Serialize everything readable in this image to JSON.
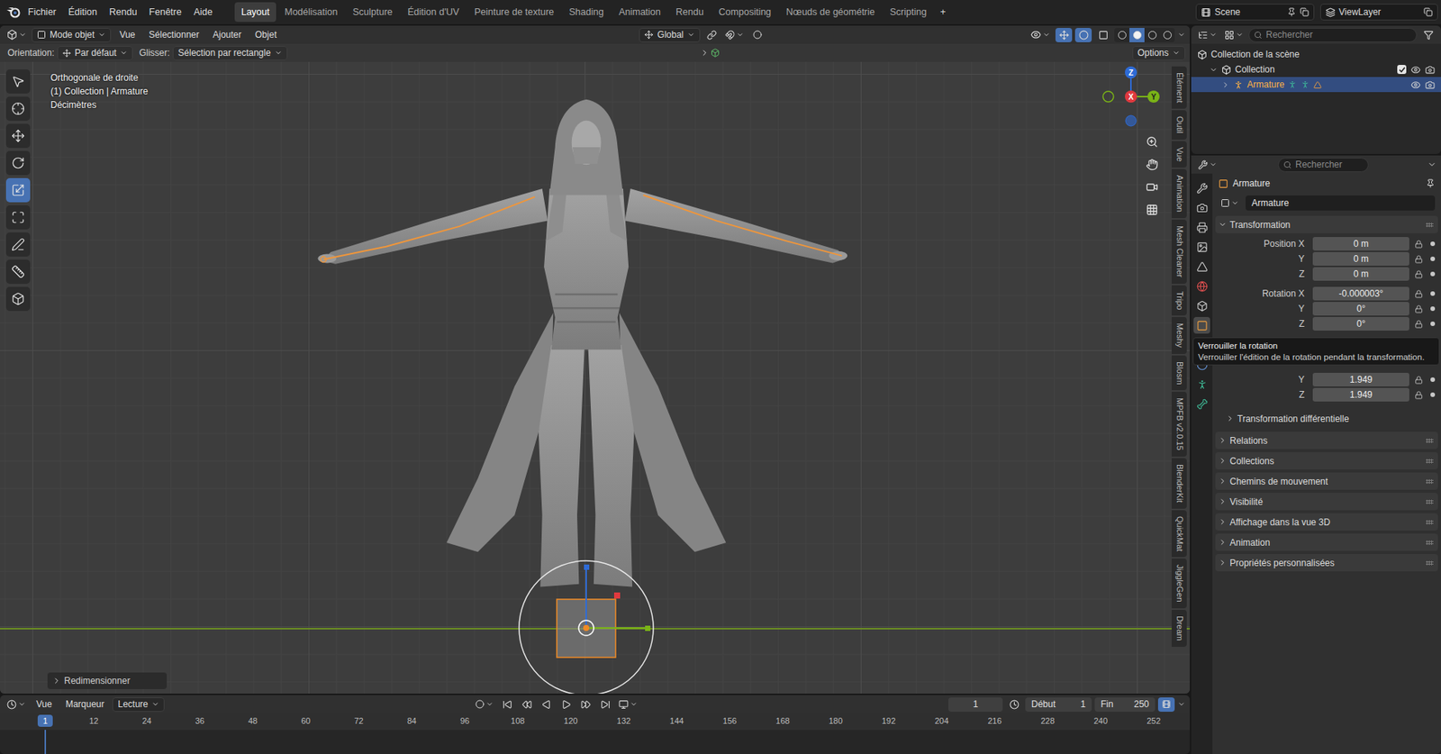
{
  "top_bar": {
    "menus": [
      "Fichier",
      "Édition",
      "Rendu",
      "Fenêtre",
      "Aide"
    ],
    "workspaces": [
      {
        "label": "Layout",
        "selected": true
      },
      {
        "label": "Modélisation",
        "selected": false
      },
      {
        "label": "Sculpture",
        "selected": false
      },
      {
        "label": "Édition d'UV",
        "selected": false
      },
      {
        "label": "Peinture de texture",
        "selected": false
      },
      {
        "label": "Shading",
        "selected": false
      },
      {
        "label": "Animation",
        "selected": false
      },
      {
        "label": "Rendu",
        "selected": false
      },
      {
        "label": "Compositing",
        "selected": false
      },
      {
        "label": "Nœuds de géométrie",
        "selected": false
      },
      {
        "label": "Scripting",
        "selected": false
      }
    ],
    "add_workspace": "+",
    "scene": "Scene",
    "view_layer": "ViewLayer"
  },
  "viewport_header": {
    "mode": "Mode objet",
    "menus": [
      "Vue",
      "Sélectionner",
      "Ajouter",
      "Objet"
    ],
    "orientation": "Global",
    "toggles": [
      {
        "name": "gizmos",
        "on": true
      },
      {
        "name": "overlays",
        "on": true
      },
      {
        "name": "xray",
        "on": false
      }
    ],
    "shading_modes": [
      {
        "name": "wireframe",
        "selected": false
      },
      {
        "name": "solid",
        "selected": true
      },
      {
        "name": "material",
        "selected": false
      },
      {
        "name": "rendered",
        "selected": false
      }
    ]
  },
  "tool_settings": {
    "orientation_label": "Orientation:",
    "orientation": "Par défaut",
    "drag_label": "Glisser:",
    "drag": "Sélection par rectangle",
    "options": "Options"
  },
  "viewport": {
    "overlay_lines": [
      "Orthogonale de droite",
      "(1) Collection | Armature",
      "Décimètres"
    ],
    "tools": [
      {
        "name": "select-box",
        "selected": false
      },
      {
        "name": "cursor",
        "selected": false
      },
      {
        "name": "move",
        "selected": false
      },
      {
        "name": "rotate",
        "selected": false
      },
      {
        "name": "scale",
        "selected": true
      },
      {
        "name": "transform",
        "selected": false
      },
      {
        "name": "annotate",
        "selected": false
      },
      {
        "name": "measure",
        "selected": false
      },
      {
        "name": "add-cube",
        "selected": false
      }
    ],
    "nav_axes": [
      {
        "label": "Z",
        "color": "#2e6bd6"
      },
      {
        "label": "X",
        "color": "#e0393e"
      },
      {
        "label": "Y",
        "color": "#7ab317"
      }
    ],
    "side_tabs": [
      "Élément",
      "Outil",
      "Vue",
      "Animation",
      "Mesh Cleaner",
      "Tripo",
      "Meshy",
      "Blosm",
      "MPFB v2.0.15",
      "BlenderKit",
      "QuickMat",
      "JiggleGen",
      "Dream"
    ],
    "last_operator": "Redimensionner"
  },
  "timeline": {
    "menus": [
      "Vue",
      "Marqueur"
    ],
    "playback": "Lecture",
    "playhead": "1",
    "current_frame": "1",
    "start_label": "Début",
    "start": "1",
    "end_label": "Fin",
    "end": "250",
    "ruler": [
      "12",
      "24",
      "36",
      "48",
      "60",
      "72",
      "84",
      "96",
      "108",
      "120",
      "132",
      "144",
      "156",
      "168",
      "180",
      "192",
      "204",
      "216",
      "228",
      "240",
      "252"
    ]
  },
  "outliner": {
    "search_placeholder": "Rechercher",
    "rows": [
      {
        "label": "Collection de la scène",
        "kind": "scene",
        "depth": 0,
        "selected": false
      },
      {
        "label": "Collection",
        "kind": "collection",
        "depth": 1,
        "selected": false
      },
      {
        "label": "Armature",
        "kind": "object",
        "depth": 2,
        "selected": true
      }
    ]
  },
  "properties": {
    "search_placeholder": "Rechercher",
    "object_title": "Armature",
    "object_name": "Armature",
    "tabs": [
      {
        "name": "tool",
        "selected": false
      },
      {
        "name": "render",
        "selected": false
      },
      {
        "name": "output",
        "selected": false
      },
      {
        "name": "view-layer",
        "selected": false
      },
      {
        "name": "scene",
        "selected": false
      },
      {
        "name": "world",
        "selected": false
      },
      {
        "name": "collection",
        "selected": false
      },
      {
        "name": "object",
        "selected": true
      },
      {
        "name": "modifiers",
        "selected": false
      },
      {
        "name": "physics",
        "selected": false
      },
      {
        "name": "object-data",
        "selected": false
      },
      {
        "name": "bone",
        "selected": false
      }
    ],
    "transform": {
      "title": "Transformation",
      "expanded": true,
      "location": [
        {
          "label": "Position X",
          "value": "0 m"
        },
        {
          "label": "Y",
          "value": "0 m"
        },
        {
          "label": "Z",
          "value": "0 m"
        }
      ],
      "rotation": [
        {
          "label": "Rotation X",
          "value": "-0.000003°"
        },
        {
          "label": "Y",
          "value": "0°"
        },
        {
          "label": "Z",
          "value": "0°"
        }
      ],
      "scale": [
        {
          "label": "Y",
          "value": "1.949"
        },
        {
          "label": "Z",
          "value": "1.949"
        }
      ],
      "subsection": {
        "title": "Transformation différentielle",
        "expanded": false
      }
    },
    "tooltip": {
      "title": "Verrouiller la rotation",
      "description": "Verrouiller l'édition de la rotation pendant la transformation."
    },
    "sections": [
      {
        "title": "Relations",
        "expanded": false
      },
      {
        "title": "Collections",
        "expanded": false
      },
      {
        "title": "Chemins de mouvement",
        "expanded": false
      },
      {
        "title": "Visibilité",
        "expanded": false
      },
      {
        "title": "Affichage dans la vue 3D",
        "expanded": false
      },
      {
        "title": "Animation",
        "expanded": false
      },
      {
        "title": "Propriétés personnalisées",
        "expanded": false
      }
    ]
  }
}
